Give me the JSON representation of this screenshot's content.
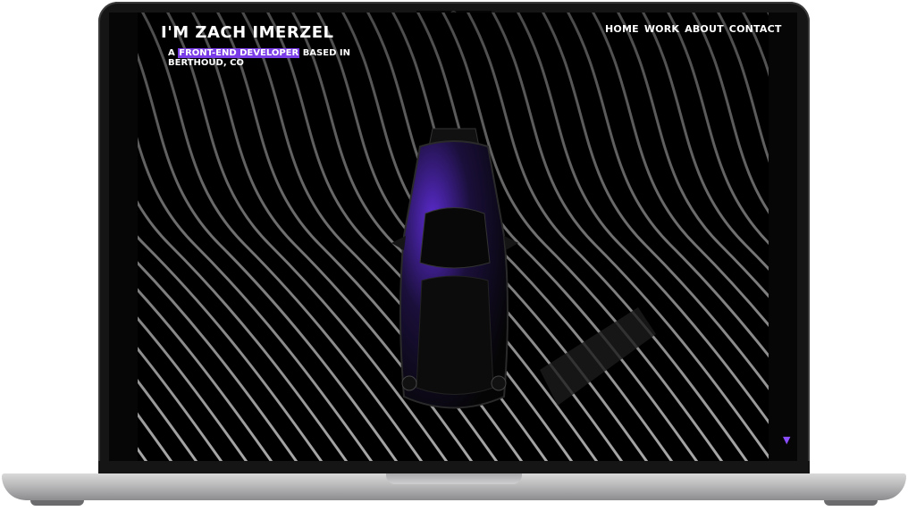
{
  "site": {
    "title": "I'M ZACH IMERZEL",
    "tagline_prefix": "A",
    "tagline_highlight": "FRONT-END DEVELOPER",
    "tagline_suffix": "BASED IN BERTHOUD, CO"
  },
  "nav": {
    "items": [
      {
        "label": "HOME"
      },
      {
        "label": "WORK"
      },
      {
        "label": "ABOUT"
      },
      {
        "label": "CONTACT"
      }
    ]
  },
  "scroll_indicator": {
    "icon": "triangle-down-icon",
    "glyph": "▼"
  },
  "colors": {
    "accent": "#7a3de8",
    "background": "#000000"
  }
}
